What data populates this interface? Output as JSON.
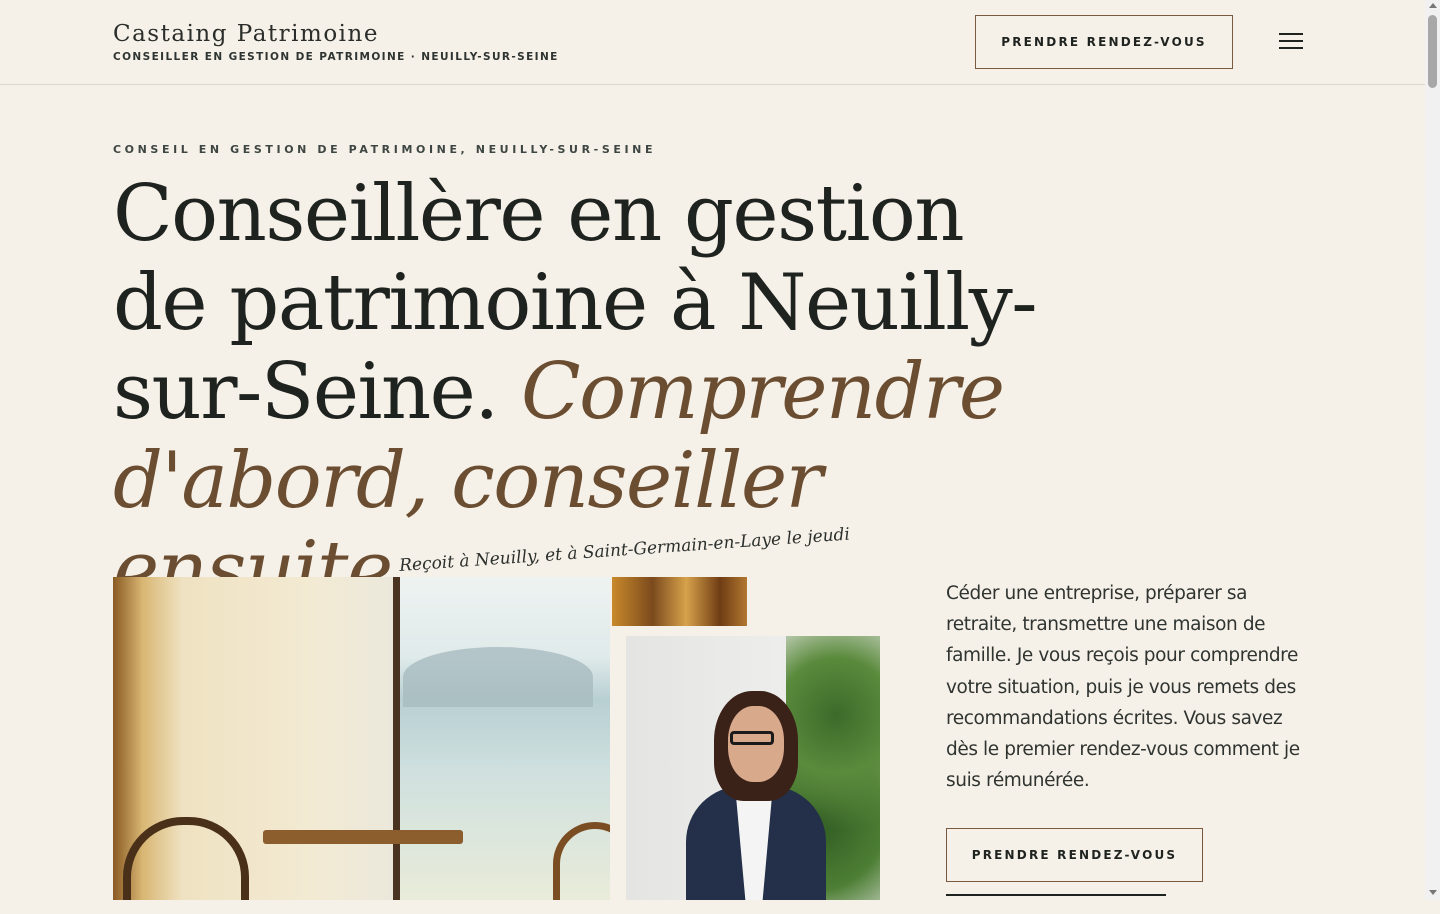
{
  "header": {
    "brand_name": "Castaing Patrimoine",
    "brand_tagline": "CONSEILLER EN GESTION DE PATRIMOINE · NEUILLY-SUR-SEINE",
    "cta_label": "PRENDRE RENDEZ-VOUS",
    "menu_icon": "hamburger-menu-icon"
  },
  "hero": {
    "eyebrow": "CONSEIL EN GESTION DE PATRIMOINE, NEUILLY-SUR-SEINE",
    "headline_plain": "Conseillère en gestion de patrimoine à Neuilly-sur-Seine.",
    "headline_accent": "Comprendre d'abord, conseiller ensuite.",
    "caption": "Reçoit à Neuilly, et à Saint-Germain-en-Laye le jeudi",
    "intro": "Céder une entreprise, préparer sa retraite, transmettre une maison de famille. Je vous reçois pour comprendre votre situation, puis je vous remets des recommandations écrites. Vous savez dès le premier rendez-vous comment je suis rémunérée.",
    "cta_label": "PRENDRE RENDEZ-VOUS"
  },
  "colors": {
    "background": "#f6f1e8",
    "text": "#1f2320",
    "accent": "#6b4e32",
    "button_border": "#7a5a3e"
  }
}
